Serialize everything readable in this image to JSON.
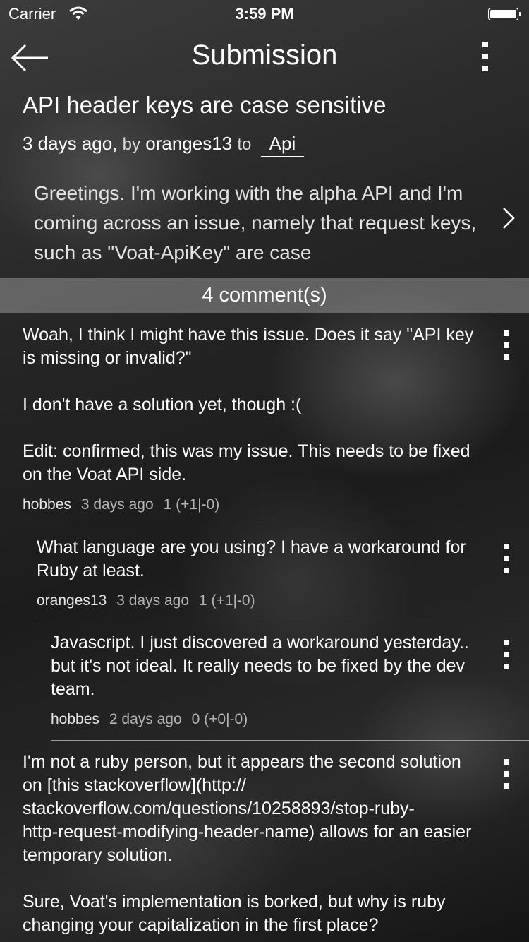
{
  "status_bar": {
    "carrier": "Carrier",
    "time": "3:59 PM"
  },
  "nav": {
    "title": "Submission",
    "back_icon": "arrow-left-icon",
    "menu_icon": "vertical-ellipsis-icon"
  },
  "submission": {
    "title": "API header keys are case sensitive",
    "time_ago": "3 days ago,",
    "by_label": "by",
    "author": "oranges13",
    "to_label": "to",
    "subverse": "Api",
    "preview": "Greetings. I'm working with the alpha API and I'm coming across an issue, namely that request keys, such as \"Voat-ApiKey\" are case"
  },
  "comments_header": "4 comment(s)",
  "comments": [
    {
      "body": "Woah, I think I might have this issue. Does it say \"API key is missing or invalid?\"\n\nI don't have a solution yet, though :(\n\nEdit: confirmed, this was my issue. This needs to be fixed on the Voat API side.",
      "author": "hobbes",
      "time": "3 days ago",
      "score": "1 (+1|-0)"
    },
    {
      "body": "What language are you using? I have a workaround for Ruby at least.",
      "author": "oranges13",
      "time": "3 days ago",
      "score": "1 (+1|-0)"
    },
    {
      "body": "Javascript. I just discovered a workaround yesterday.. but it's not ideal. It really needs to be fixed by the dev team.",
      "author": "hobbes",
      "time": "2 days ago",
      "score": "0 (+0|-0)"
    },
    {
      "body": "I'm not a ruby person, but it appears the second solution on [this stackoverflow](http://\nstackoverflow.com/questions/10258893/stop-ruby-\nhttp-request-modifying-header-name) allows for an easier temporary solution.\n\nSure, Voat's implementation is borked, but why is ruby changing your capitalization in the first place?"
    }
  ]
}
